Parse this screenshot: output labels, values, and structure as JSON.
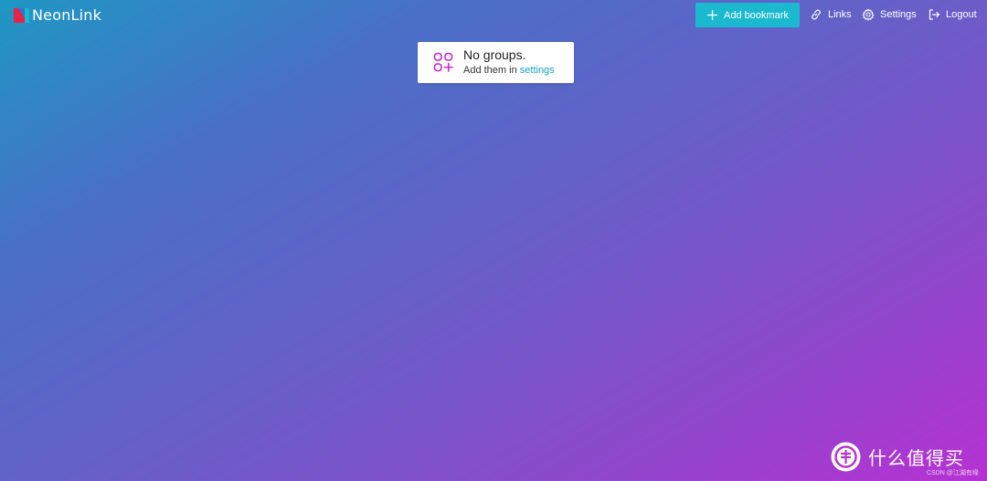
{
  "header": {
    "app_name": "NeonLink",
    "add_bookmark_label": "Add bookmark",
    "nav": {
      "links_label": "Links",
      "settings_label": "Settings",
      "logout_label": "Logout"
    }
  },
  "empty_state": {
    "title": "No groups.",
    "subtitle_prefix": "Add them in ",
    "subtitle_link": "settings"
  },
  "watermark": {
    "text": "什么值得买",
    "caption": "CSDN @江湖有缘"
  },
  "colors": {
    "accent": "#1ab9cf",
    "link": "#1aa3c0",
    "icon_magenta": "#c026d3",
    "gradient_start": "#1f97c4",
    "gradient_end": "#b631d2"
  },
  "icons": {
    "logo": "neonlink-logo",
    "add": "plus-icon",
    "links": "link-icon",
    "settings": "gear-icon",
    "logout": "logout-icon",
    "empty": "add-group-icon"
  }
}
